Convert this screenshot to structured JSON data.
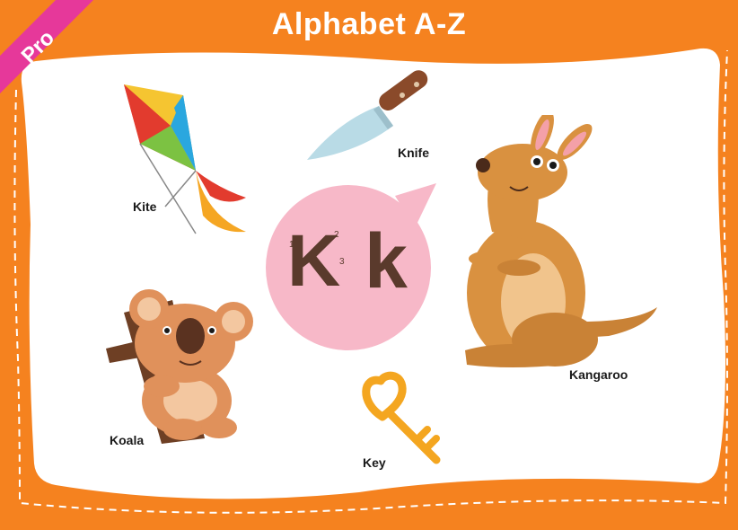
{
  "header": {
    "title": "Alphabet A-Z"
  },
  "badge": {
    "label": "Pro",
    "color": "#e6389a"
  },
  "letter": {
    "upper": "K",
    "lower": "k",
    "bubble_color": "#f7b8c8"
  },
  "items": [
    {
      "id": "kite",
      "label": "Kite"
    },
    {
      "id": "knife",
      "label": "Knife"
    },
    {
      "id": "kangaroo",
      "label": "Kangaroo"
    },
    {
      "id": "koala",
      "label": "Koala"
    },
    {
      "id": "key",
      "label": "Key"
    }
  ],
  "stroke_numbers": {
    "one": "1",
    "two": "2",
    "three": "3"
  },
  "colors": {
    "frame": "#f5821f",
    "card": "#ffffff"
  }
}
